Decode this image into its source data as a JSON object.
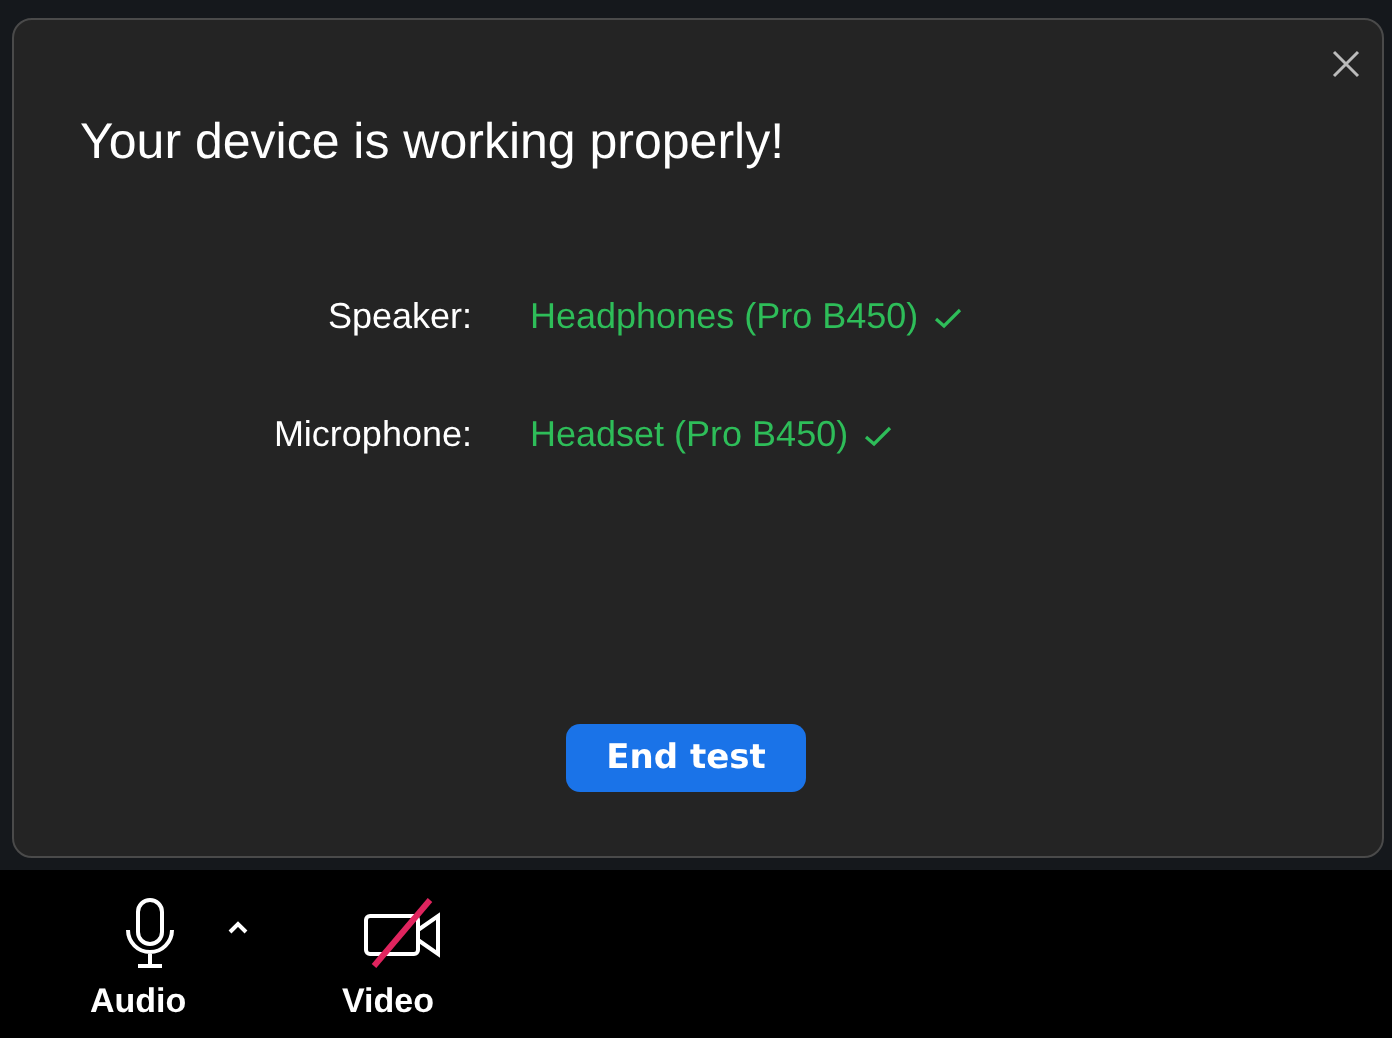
{
  "dialog": {
    "title": "Your device is working properly!",
    "devices": [
      {
        "label": "Speaker:",
        "value": "Headphones (Pro B450)",
        "ok": true
      },
      {
        "label": "Microphone:",
        "value": "Headset (Pro B450)",
        "ok": true
      }
    ],
    "button": "End test"
  },
  "toolbar": [
    {
      "kind": "audio",
      "label": "Audio",
      "off": false,
      "has_menu": true
    },
    {
      "kind": "video",
      "label": "Video",
      "off": true,
      "has_menu": false
    }
  ]
}
